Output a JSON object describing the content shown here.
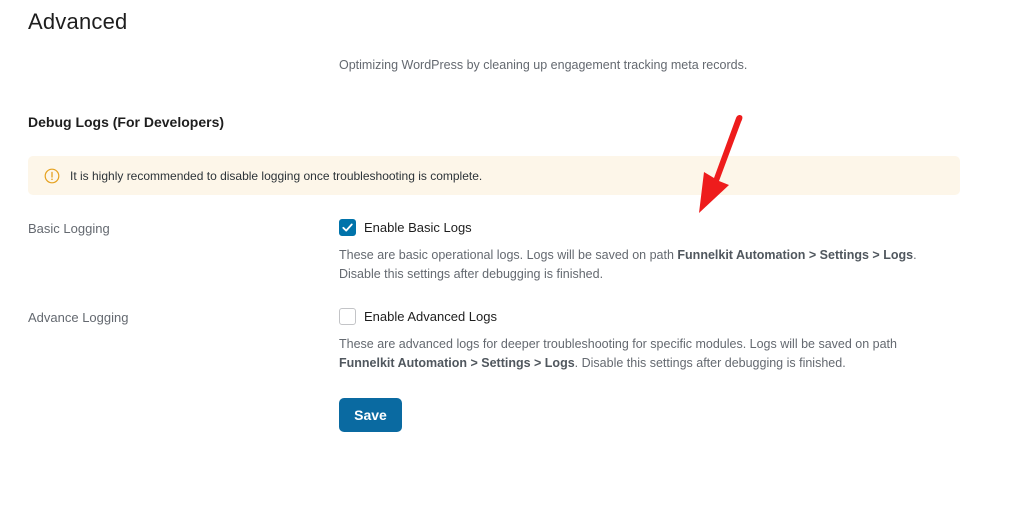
{
  "page": {
    "title": "Advanced",
    "intro": "Optimizing WordPress by cleaning up engagement tracking meta records."
  },
  "debug_logs": {
    "section_title": "Debug Logs (For Developers)",
    "notice": {
      "icon": "info-circle-icon",
      "text": "It is highly recommended to disable logging once troubleshooting is complete.",
      "background_color": "#fdf6e9",
      "icon_color": "#e5a11f"
    },
    "basic": {
      "label": "Basic Logging",
      "checkbox_label": "Enable Basic Logs",
      "checked": true,
      "desc_before": "These are basic operational logs. Logs will be saved on path ",
      "desc_path": "Funnelkit Automation > Settings > Logs",
      "desc_after": ". Disable this settings after debugging is finished."
    },
    "advanced": {
      "label": "Advance Logging",
      "checkbox_label": "Enable Advanced Logs",
      "checked": false,
      "desc_before": "These are advanced logs for deeper troubleshooting for specific modules. Logs will be saved on path ",
      "desc_path": "Funnelkit Automation > Settings > Logs",
      "desc_after": ". Disable this settings after debugging is finished."
    }
  },
  "actions": {
    "save_label": "Save"
  },
  "colors": {
    "accent": "#0073aa",
    "button": "#0a6aa1",
    "annotation_arrow": "#ee1c1c"
  },
  "annotation": {
    "icon": "red-arrow-icon"
  }
}
